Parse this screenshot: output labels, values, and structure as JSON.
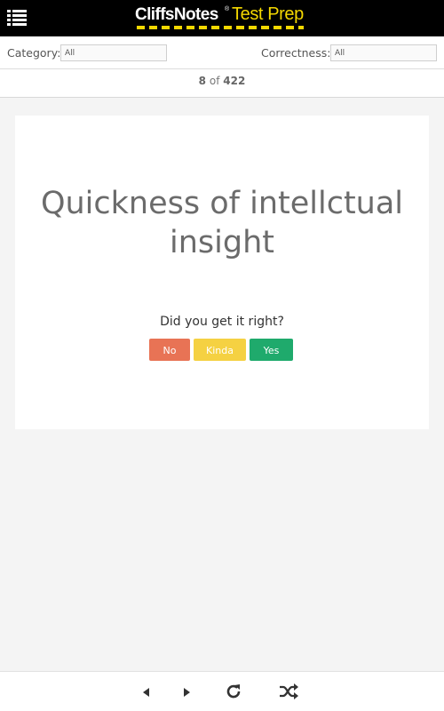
{
  "header": {
    "brand_main": "CliffsNotes",
    "brand_mark": "®",
    "brand_sub": "Test Prep",
    "menu_icon": "hamburger-list-icon"
  },
  "filters": {
    "category_label": "Category:",
    "category_value": "All",
    "correctness_label": "Correctness:",
    "correctness_value": "All"
  },
  "counter": {
    "current": "8",
    "of": "of",
    "total": "422"
  },
  "card": {
    "term": "Quickness of intellctual insight",
    "question": "Did you get it right?",
    "buttons": {
      "no": "No",
      "kinda": "Kinda",
      "yes": "Yes"
    }
  },
  "colors": {
    "header_bg": "#000000",
    "brand_accent": "#f5d800",
    "no": "#e87355",
    "kinda": "#f5d142",
    "yes": "#1faa6c"
  },
  "toolbar": {
    "icons": [
      "previous-icon",
      "next-icon",
      "refresh-icon",
      "shuffle-icon"
    ]
  }
}
